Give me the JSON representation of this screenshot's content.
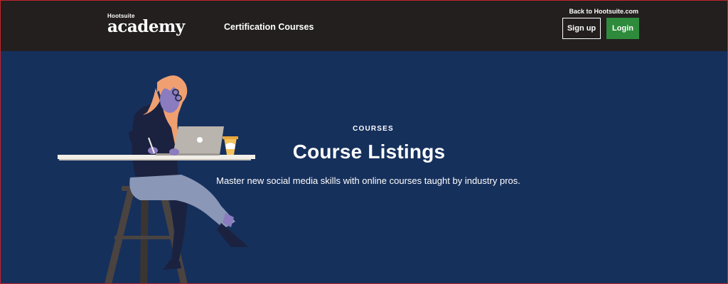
{
  "header": {
    "logo_small": "Hootsuite",
    "logo_big": "academy",
    "nav_link": "Certification Courses",
    "back_link": "Back to Hootsuite.com",
    "signup_label": "Sign up",
    "login_label": "Login"
  },
  "hero": {
    "eyebrow": "COURSES",
    "title": "Course Listings",
    "subtitle": "Master new social media skills with online courses taught by industry pros."
  },
  "colors": {
    "header_bg": "#231f1f",
    "hero_bg": "#16305c",
    "login_bg": "#2e8b3c",
    "hair": "#f0a070"
  }
}
